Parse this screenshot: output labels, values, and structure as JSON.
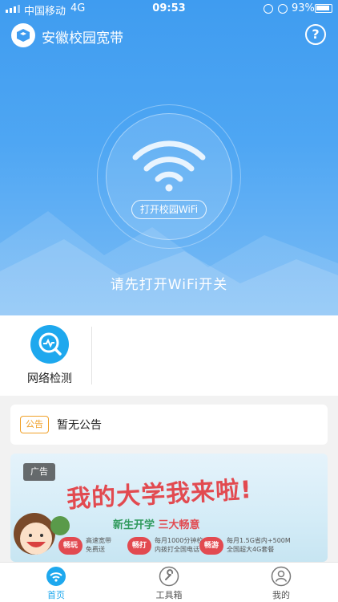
{
  "status_bar": {
    "carrier": "中国移动",
    "network": "4G",
    "time": "09:53",
    "battery": "93%"
  },
  "app_bar": {
    "title": "安徽校园宽带",
    "help_icon": "question-circle-icon"
  },
  "hero": {
    "wifi_icon": "wifi-icon",
    "open_button": "打开校园WiFi",
    "hint": "请先打开WiFi开关"
  },
  "tools": [
    {
      "label": "网络检测",
      "icon": "network-check-icon"
    }
  ],
  "notice": {
    "tag": "公告",
    "text": "暂无公告"
  },
  "ad": {
    "tag": "广告",
    "title": "我的大学我来啦!",
    "subtitle_prefix": "新生开学 ",
    "subtitle_highlight": "三大畅意",
    "items": [
      {
        "pill": "畅玩",
        "line1": "高速宽带",
        "line2": "免费送"
      },
      {
        "pill": "畅打",
        "line1": "每月1000分钟校",
        "line2": "内拨打全国电话"
      },
      {
        "pill": "畅游",
        "line1": "每月1.5G省内+500M",
        "line2": "全国超大4G套餐"
      }
    ]
  },
  "tab_bar": {
    "tabs": [
      {
        "label": "首页",
        "icon": "wifi-home-icon",
        "active": true
      },
      {
        "label": "工具箱",
        "icon": "wrench-icon",
        "active": false
      },
      {
        "label": "我的",
        "icon": "user-icon",
        "active": false
      }
    ]
  },
  "colors": {
    "primary": "#3f9cf0",
    "accent": "#1ea8ee",
    "notice_tag": "#f0a028",
    "ad_red": "#e24a50"
  }
}
